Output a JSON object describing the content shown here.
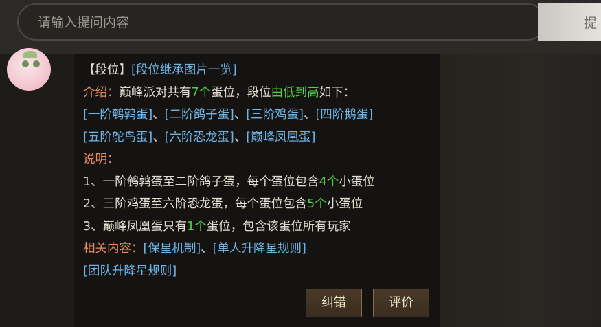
{
  "search": {
    "placeholder": "请输入提问内容",
    "submit_label": "提"
  },
  "message": {
    "heading": "【段位】",
    "heading_link": "[段位继承图片一览]",
    "intro_label": "介绍：",
    "intro_text_1": "巅峰派对共有",
    "intro_count": "7个",
    "intro_text_2": "蛋位，段位",
    "intro_order": "由低到高",
    "intro_text_3": "如下：",
    "ranks": [
      "[一阶鹌鹑蛋]",
      "[二阶鸽子蛋]",
      "[三阶鸡蛋]",
      "[四阶鹅蛋]",
      "[五阶鸵鸟蛋]",
      "[六阶恐龙蛋]",
      "[巅峰凤凰蛋]"
    ],
    "rank_sep": "、",
    "explain_label": "说明：",
    "rules": [
      {
        "before": "1、一阶鹌鹑蛋至二阶鸽子蛋，每个蛋位包含",
        "count": "4个",
        "after": "小蛋位"
      },
      {
        "before": "2、三阶鸡蛋至六阶恐龙蛋，每个蛋位包含",
        "count": "5个",
        "after": "小蛋位"
      },
      {
        "before": "3、巅峰凤凰蛋只有",
        "count": "1个",
        "after": "蛋位，包含该蛋位所有玩家"
      }
    ],
    "related_label": "相关内容：",
    "related_links": [
      "[保星机制]",
      "[单人升降星规则]",
      "[团队升降星规则]"
    ]
  },
  "actions": {
    "correct_label": "纠错",
    "rate_label": "评价"
  }
}
